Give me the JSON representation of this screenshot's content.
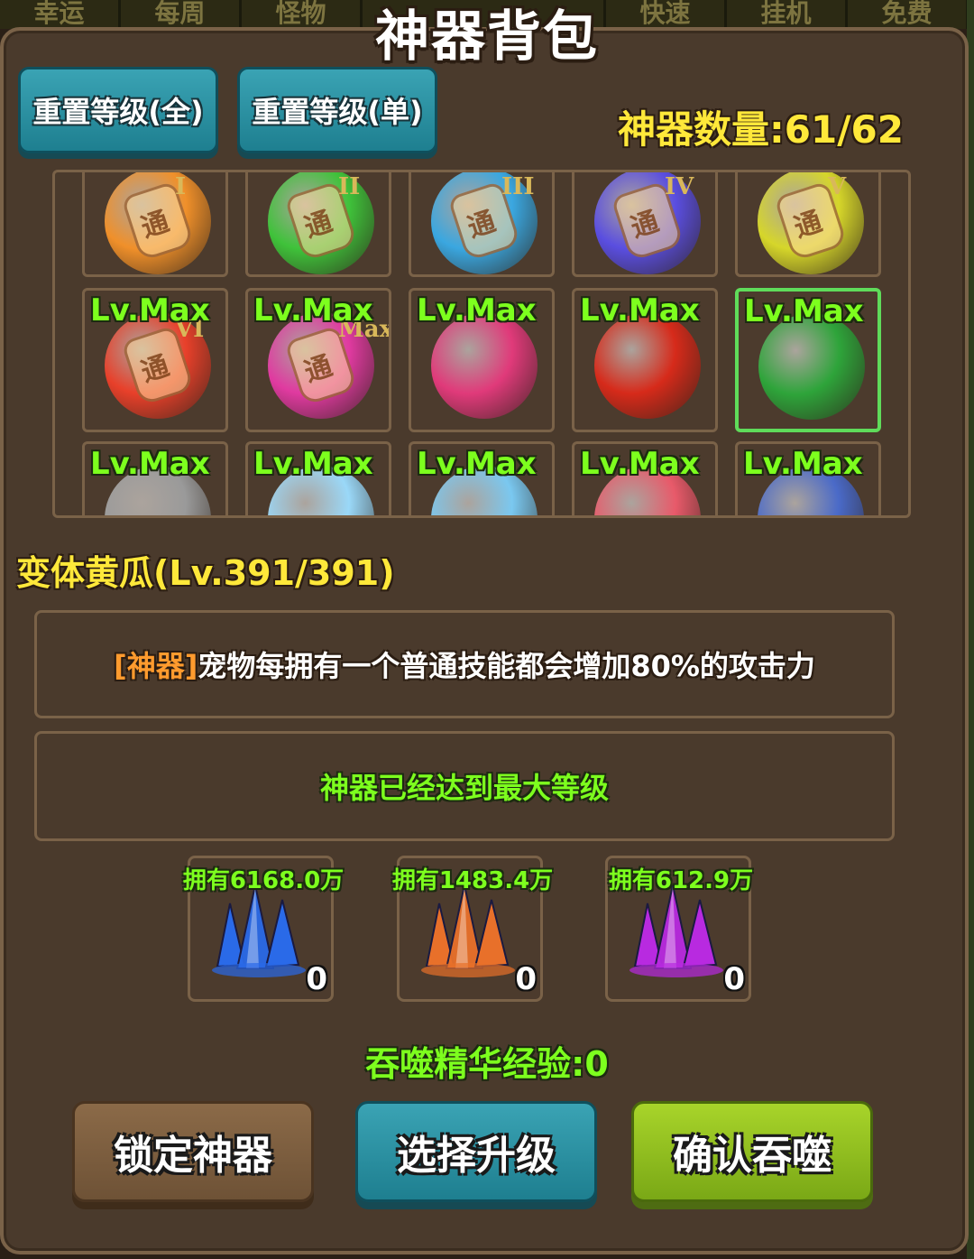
{
  "top_tabs": [
    "幸运",
    "每周",
    "怪物",
    "快速",
    "挂机",
    "免费"
  ],
  "title": "神器背包",
  "reset_all_label": "重置等级(全)",
  "reset_single_label": "重置等级(单)",
  "artifact_count": "神器数量:61/62",
  "grid": {
    "rows": [
      [
        {
          "color": "#f0902a",
          "roman": "I",
          "lv": ""
        },
        {
          "color": "#3fc23a",
          "roman": "II",
          "lv": ""
        },
        {
          "color": "#3aa7e0",
          "roman": "III",
          "lv": ""
        },
        {
          "color": "#5a4ee0",
          "roman": "IV",
          "lv": ""
        },
        {
          "color": "#d6d62a",
          "roman": "V",
          "lv": ""
        }
      ],
      [
        {
          "color": "#e8402a",
          "roman": "VI",
          "lv": "Lv.Max"
        },
        {
          "color": "#e03aa0",
          "roman": "Max",
          "lv": "Lv.Max"
        },
        {
          "color": "#e03a7a",
          "roman": "",
          "lv": "Lv.Max"
        },
        {
          "color": "#d62a1a",
          "roman": "",
          "lv": "Lv.Max"
        },
        {
          "color": "#2ea43a",
          "roman": "",
          "lv": "Lv.Max"
        }
      ],
      [
        {
          "color": "#9a9a9a",
          "roman": "",
          "lv": "Lv.Max"
        },
        {
          "color": "#9ad8f8",
          "roman": "",
          "lv": "Lv.Max"
        },
        {
          "color": "#7ac8f0",
          "roman": "",
          "lv": "Lv.Max"
        },
        {
          "color": "#e85a6a",
          "roman": "",
          "lv": "Lv.Max"
        },
        {
          "color": "#4a6ac8",
          "roman": "",
          "lv": "Lv.Max"
        }
      ]
    ],
    "coin_glyph": "通"
  },
  "item_name": "变体黄瓜(Lv.391/391)",
  "description_tag": "[神器]",
  "description_text": "宠物每拥有一个普通技能都会增加80%的攻击力",
  "max_level_message": "神器已经达到最大等级",
  "resources": [
    {
      "owned": "拥有6168.0万",
      "qty": "0",
      "color": "#2a6ae8",
      "icon": "blue-crystal-icon"
    },
    {
      "owned": "拥有1483.4万",
      "qty": "0",
      "color": "#e8702a",
      "icon": "orange-crystal-icon"
    },
    {
      "owned": "拥有612.9万",
      "qty": "0",
      "color": "#b82ae0",
      "icon": "purple-crystal-icon"
    }
  ],
  "devour_exp": "吞噬精华经验:0",
  "buttons": {
    "lock": "锁定神器",
    "select": "选择升级",
    "confirm": "确认吞噬"
  }
}
